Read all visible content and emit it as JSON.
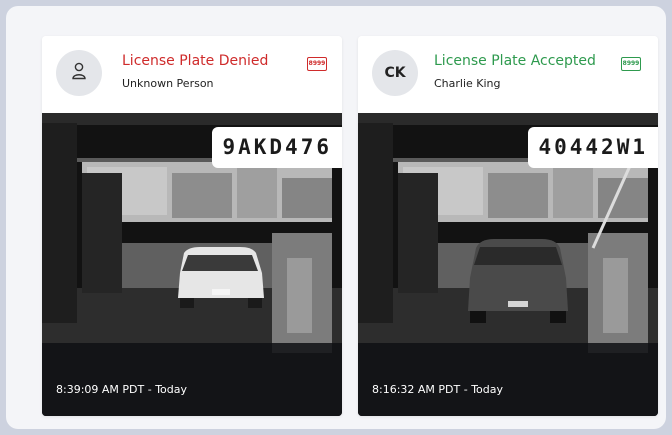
{
  "cards": [
    {
      "status_title": "License Plate Denied",
      "person_name": "Unknown Person",
      "avatar_initials": "",
      "avatar_icon": "person-outline-icon",
      "plate_icon": "license-plate-icon",
      "plate_icon_text": "8999",
      "plate_number": "9AKD476",
      "timestamp": "8:39:09 AM PDT - Today",
      "status_color": "#cf2b2b",
      "car_color": "white"
    },
    {
      "status_title": "License Plate Accepted",
      "person_name": "Charlie King",
      "avatar_initials": "CK",
      "plate_icon": "license-plate-icon",
      "plate_icon_text": "8999",
      "plate_number": "40442W1",
      "timestamp": "8:16:32 AM PDT - Today",
      "status_color": "#2e9a4e",
      "car_color": "dark gray"
    }
  ]
}
